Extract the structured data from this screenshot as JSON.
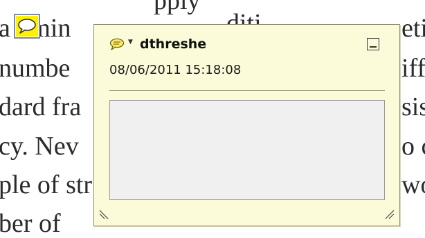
{
  "document": {
    "lines": [
      {
        "text": "pply"
      },
      {
        "text": "a  umin"
      },
      {
        "text": "numbe"
      },
      {
        "text": "dard fra"
      },
      {
        "text": "cy. Nev"
      },
      {
        "text": "ple of str"
      },
      {
        "text": "ber of"
      }
    ],
    "right_fragments": [
      {
        "text": "diti"
      },
      {
        "text": "eti"
      },
      {
        "text": "iff"
      },
      {
        "text": "sis"
      },
      {
        "text": "o c"
      },
      {
        "text": "wo"
      }
    ]
  },
  "annotation": {
    "marker_icon": "speech-bubble-icon",
    "marker_color": "#fff200"
  },
  "popup": {
    "icon": "speech-bubble-icon",
    "menu_icon": "caret-down-icon",
    "author": "dthreshe",
    "datetime": "08/06/2011 15:18:08",
    "comment_text": "",
    "minimize_icon": "minimize-icon",
    "background": "#fbfbd9"
  }
}
